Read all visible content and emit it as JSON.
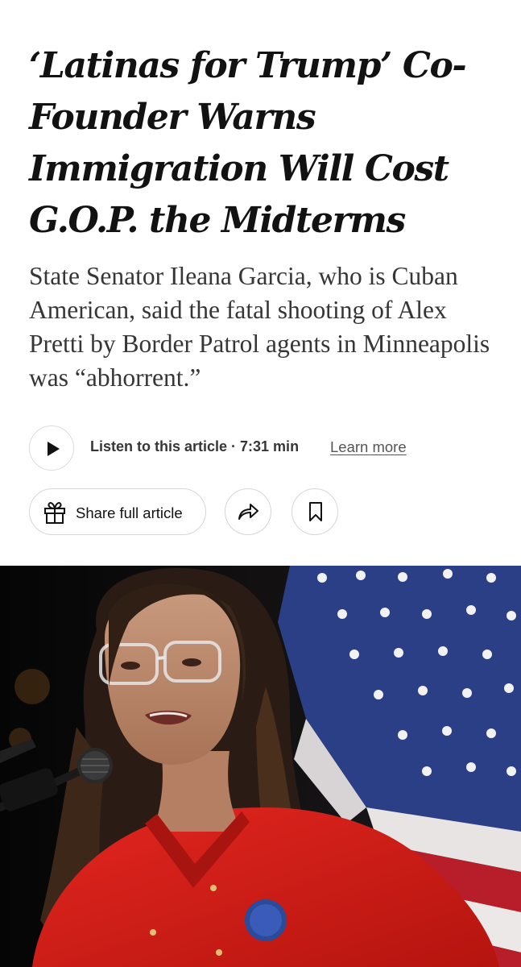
{
  "article": {
    "headline": "‘Latinas for Trump’ Co-Founder Warns Immigration Will Cost G.O.P. the Midterms",
    "summary": "State Senator Ileana Garcia, who is Cuban American, said the fatal shooting of Alex Pretti by Border Patrol agents in Minneapolis was “abhorrent.”"
  },
  "audio": {
    "play_icon": "play-icon",
    "listen_label": "Listen to this article · 7:31 min",
    "learn_more": "Learn more"
  },
  "actions": {
    "share_label": "Share full article",
    "share_icon": "gift-icon",
    "forward_icon": "share-arrow-icon",
    "bookmark_icon": "bookmark-icon"
  },
  "photo": {
    "colors": {
      "background": "#0b0b0b",
      "shirt": "#d8201c",
      "flag_blue": "#2b3f86",
      "flag_red": "#b81e2a"
    }
  }
}
